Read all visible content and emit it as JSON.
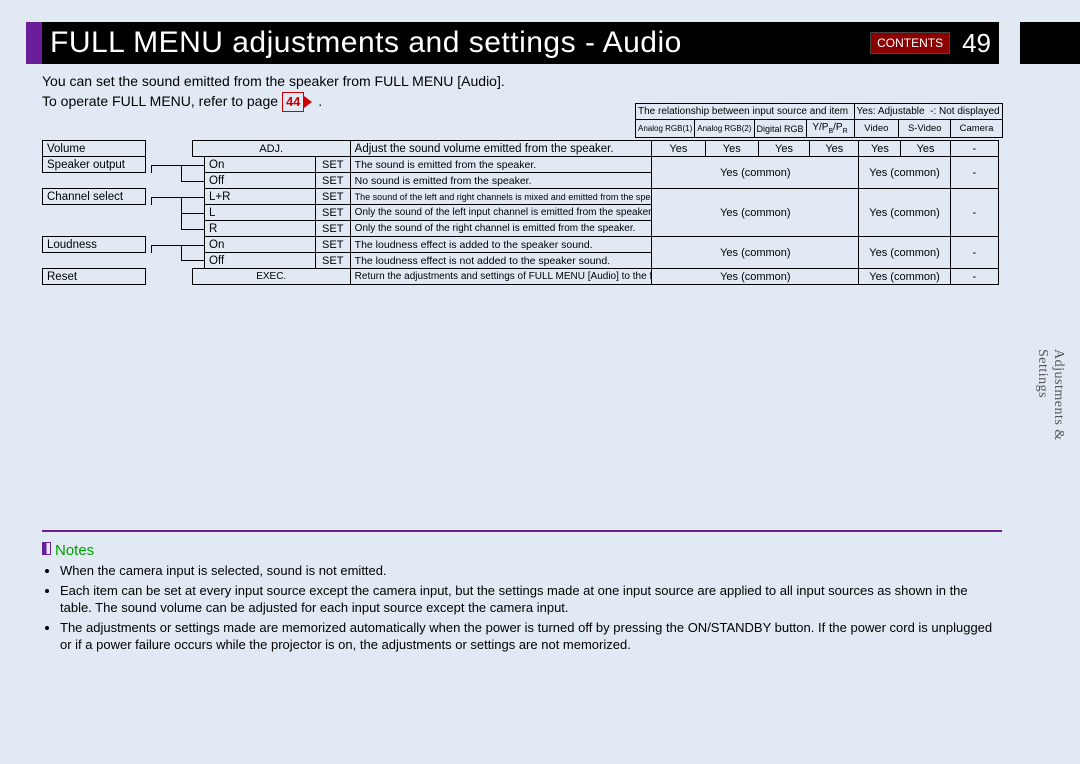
{
  "header": {
    "title": "FULL MENU adjustments and settings - Audio",
    "contents_label": "CONTENTS",
    "page_no": "49"
  },
  "intro": {
    "line1": "You can set the sound emitted from the speaker from FULL MENU [Audio].",
    "line2_pre": "To operate FULL MENU, refer to page ",
    "page_ref": "44",
    "line2_post": " ."
  },
  "rel": {
    "caption": "The relationship between input source and item",
    "yes_label": "Yes: Adjustable",
    "dash_label": "-: Not displayed",
    "cols": [
      "Analog RGB(1)",
      "Analog RGB(2)",
      "Digital RGB",
      "Y/PB/PR",
      "Video",
      "S-Video",
      "Camera"
    ]
  },
  "rows": {
    "volume": {
      "label": "Volume",
      "type": "ADJ.",
      "desc": "Adjust the sound volume emitted from the speaker.",
      "vals": [
        "Yes",
        "Yes",
        "Yes",
        "Yes",
        "Yes",
        "Yes",
        "-"
      ]
    },
    "speaker": {
      "label": "Speaker output",
      "opts": [
        {
          "opt": "On",
          "set": "SET",
          "desc": "The sound is emitted from the speaker."
        },
        {
          "opt": "Off",
          "set": "SET",
          "desc": "No sound is emitted from the speaker."
        }
      ],
      "val_a": "Yes (common)",
      "val_b": "Yes (common)",
      "val_c": "-"
    },
    "channel": {
      "label": "Channel select",
      "opts": [
        {
          "opt": "L+R",
          "set": "SET",
          "desc": "The sound of the left and right channels is mixed and emitted from the speaker."
        },
        {
          "opt": "L",
          "set": "SET",
          "desc": "Only the sound of the left input channel is emitted from the speaker."
        },
        {
          "opt": "R",
          "set": "SET",
          "desc": "Only the sound of the right channel is emitted from the speaker."
        }
      ],
      "val_a": "Yes (common)",
      "val_b": "Yes (common)",
      "val_c": "-"
    },
    "loudness": {
      "label": "Loudness",
      "opts": [
        {
          "opt": "On",
          "set": "SET",
          "desc": "The loudness effect is added to the speaker sound."
        },
        {
          "opt": "Off",
          "set": "SET",
          "desc": "The loudness effect is not added to the speaker sound."
        }
      ],
      "val_a": "Yes (common)",
      "val_b": "Yes (common)",
      "val_c": "-"
    },
    "reset": {
      "label": "Reset",
      "type": "EXEC.",
      "desc": "Return the adjustments and settings of FULL MENU [Audio] to the factory default values.",
      "val_a": "Yes (common)",
      "val_b": "Yes (common)",
      "val_c": "-"
    }
  },
  "side_tab": "Adjustments &\nSettings",
  "notes": {
    "header": "Notes",
    "items": [
      "When the camera input is selected, sound is not emitted.",
      "Each item can be set at every input source except the camera input, but the settings made at one input source are applied to all input sources as shown in the table. The sound volume can be adjusted for each input source except the camera input.",
      "The adjustments or settings made are memorized automatically when the power is turned off by pressing the ON/STANDBY button. If the power cord is unplugged or if a power failure occurs while the projector is on, the adjustments or settings are not memorized."
    ]
  }
}
